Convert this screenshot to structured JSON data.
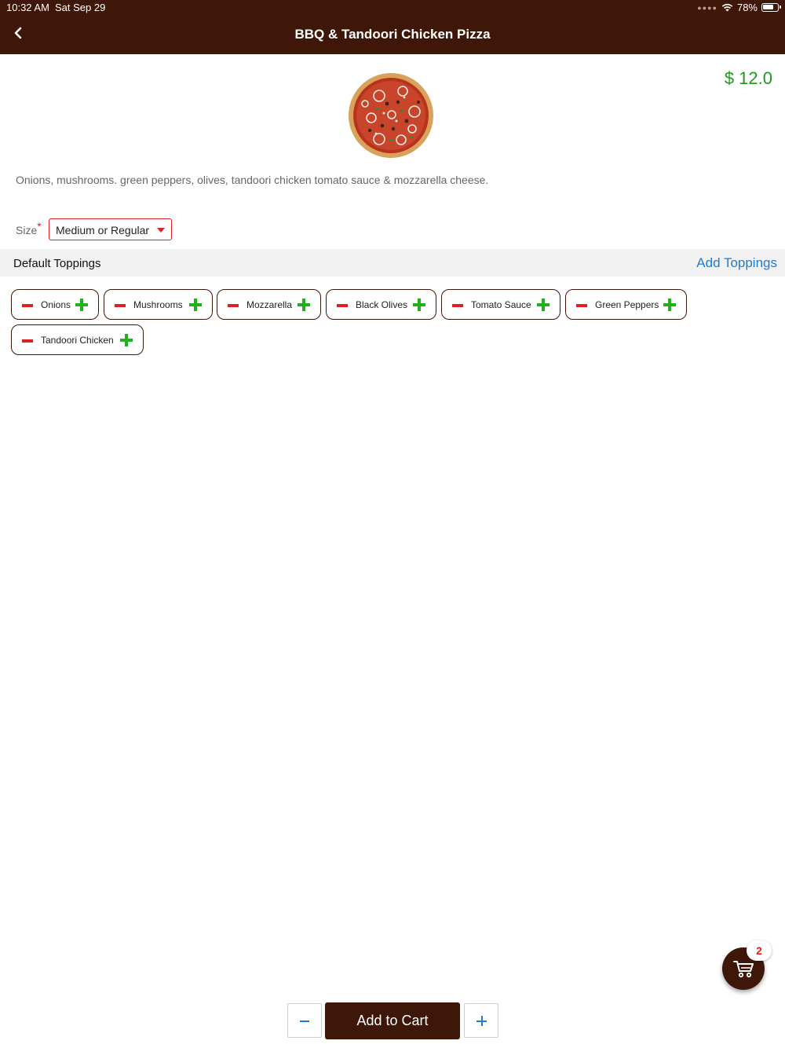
{
  "status_bar": {
    "time": "10:32 AM",
    "date": "Sat Sep 29",
    "battery": "78%"
  },
  "nav": {
    "title": "BBQ & Tandoori Chicken Pizza"
  },
  "product": {
    "price": "$ 12.0",
    "description": "Onions, mushrooms. green peppers, olives, tandoori chicken tomato sauce & mozzarella cheese."
  },
  "size": {
    "label": "Size",
    "required_mark": "*",
    "selected": "Medium or Regular"
  },
  "toppings_section": {
    "title": "Default Toppings",
    "add_label": "Add Toppings"
  },
  "toppings": [
    {
      "label": "Onions"
    },
    {
      "label": "Mushrooms"
    },
    {
      "label": "Mozzarella"
    },
    {
      "label": "Black Olives"
    },
    {
      "label": "Tomato Sauce"
    },
    {
      "label": "Green Peppers"
    },
    {
      "label": "Tandoori Chicken"
    }
  ],
  "cart": {
    "badge_count": "2"
  },
  "footer": {
    "add_to_cart": "Add to Cart"
  },
  "colors": {
    "brand": "#3f1708",
    "price": "#1d9a1d",
    "link": "#1a7ed8",
    "danger": "#e02020",
    "add": "#1fb11f"
  }
}
